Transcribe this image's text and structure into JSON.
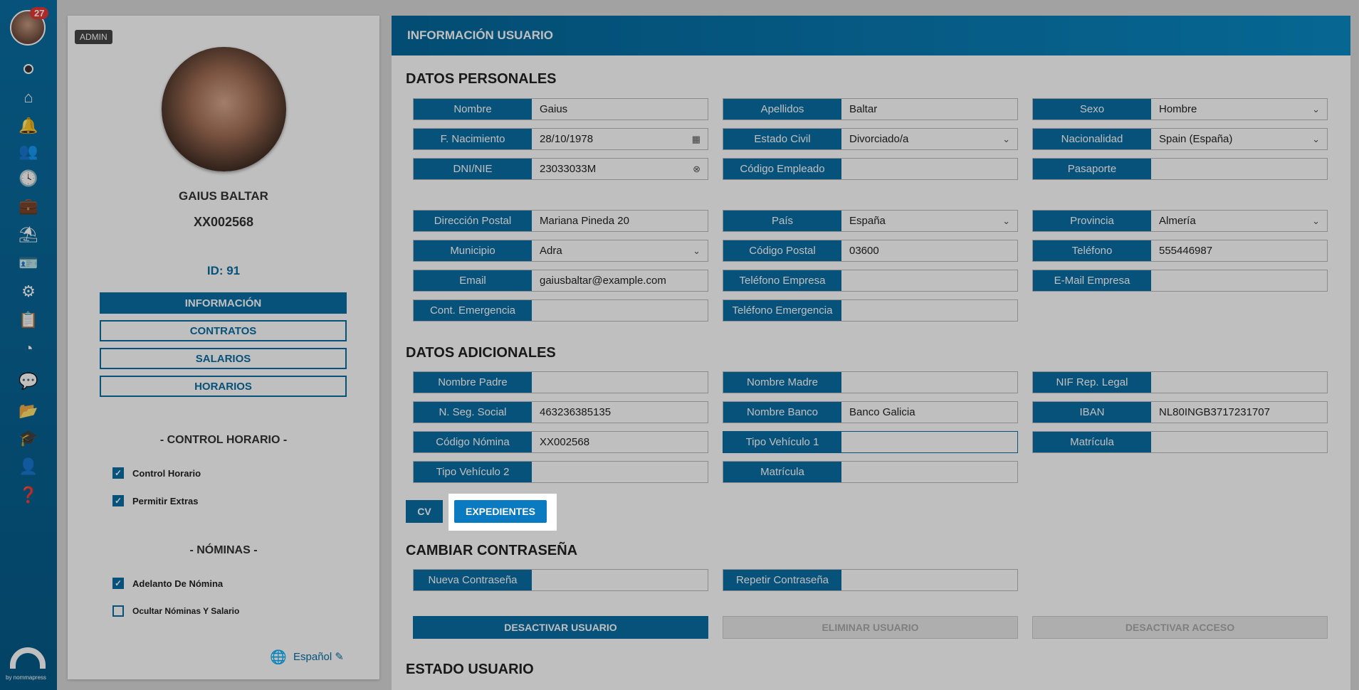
{
  "rail": {
    "badge": "27",
    "brand_by": "by nommapress"
  },
  "profile": {
    "role_badge": "ADMIN",
    "name": "GAIUS BALTAR",
    "code": "XX002568",
    "id_label": "ID: 91",
    "tabs": [
      "INFORMACIÓN",
      "CONTRATOS",
      "SALARIOS",
      "HORARIOS"
    ],
    "control_title": "- CONTROL HORARIO -",
    "control_items": [
      {
        "label": "Control Horario",
        "checked": true
      },
      {
        "label": "Permitir Extras",
        "checked": true
      }
    ],
    "nominas_title": "- NÓMINAS -",
    "nominas_items": [
      {
        "label": "Adelanto De Nómina",
        "checked": true
      },
      {
        "label": "Ocultar Nóminas Y Salario",
        "checked": false
      }
    ],
    "language": "Español"
  },
  "main": {
    "header": "INFORMACIÓN USUARIO",
    "personal_title": "DATOS PERSONALES",
    "personal": [
      {
        "label": "Nombre",
        "value": "Gaius"
      },
      {
        "label": "Apellidos",
        "value": "Baltar"
      },
      {
        "label": "Sexo",
        "value": "Hombre",
        "select": true
      },
      {
        "label": "F. Nacimiento",
        "value": "28/10/1978",
        "date": true
      },
      {
        "label": "Estado Civil",
        "value": "Divorciado/a",
        "select": true
      },
      {
        "label": "Nacionalidad",
        "value": "Spain (España)",
        "select": true
      },
      {
        "label": "DNI/NIE",
        "value": "23033033M",
        "clear": true
      },
      {
        "label": "Código Empleado",
        "value": ""
      },
      {
        "label": "Pasaporte",
        "value": ""
      },
      {
        "label": "Dirección Postal",
        "value": "Mariana Pineda 20"
      },
      {
        "label": "País",
        "value": "España",
        "select": true
      },
      {
        "label": "Provincia",
        "value": "Almería",
        "select": true
      },
      {
        "label": "Municipio",
        "value": "Adra",
        "select": true
      },
      {
        "label": "Código Postal",
        "value": "03600"
      },
      {
        "label": "Teléfono",
        "value": "555446987"
      },
      {
        "label": "Email",
        "value": "gaiusbaltar@example.com"
      },
      {
        "label": "Teléfono Empresa",
        "value": ""
      },
      {
        "label": "E-Mail Empresa",
        "value": ""
      },
      {
        "label": "Cont. Emergencia",
        "value": ""
      },
      {
        "label": "Teléfono Emergencia",
        "value": ""
      }
    ],
    "additional_title": "DATOS ADICIONALES",
    "additional": [
      {
        "label": "Nombre Padre",
        "value": ""
      },
      {
        "label": "Nombre Madre",
        "value": ""
      },
      {
        "label": "NIF Rep. Legal",
        "value": ""
      },
      {
        "label": "N. Seg. Social",
        "value": "463236385135"
      },
      {
        "label": "Nombre Banco",
        "value": "Banco Galicia"
      },
      {
        "label": "IBAN",
        "value": "NL80INGB3717231707"
      },
      {
        "label": "Código Nómina",
        "value": "XX002568"
      },
      {
        "label": "Tipo Vehículo 1",
        "value": ""
      },
      {
        "label": "Matrícula",
        "value": ""
      },
      {
        "label": "Tipo Vehículo 2",
        "value": ""
      },
      {
        "label": "Matrícula",
        "value": ""
      }
    ],
    "cv_button": "CV",
    "expedientes_button": "EXPEDIENTES",
    "password_title": "CAMBIAR CONTRASEÑA",
    "password": [
      {
        "label": "Nueva Contraseña",
        "value": ""
      },
      {
        "label": "Repetir Contraseña",
        "value": ""
      }
    ],
    "actions": [
      "DESACTIVAR USUARIO",
      "ELIMINAR USUARIO",
      "DESACTIVAR ACCESO"
    ],
    "status_title": "ESTADO USUARIO"
  }
}
